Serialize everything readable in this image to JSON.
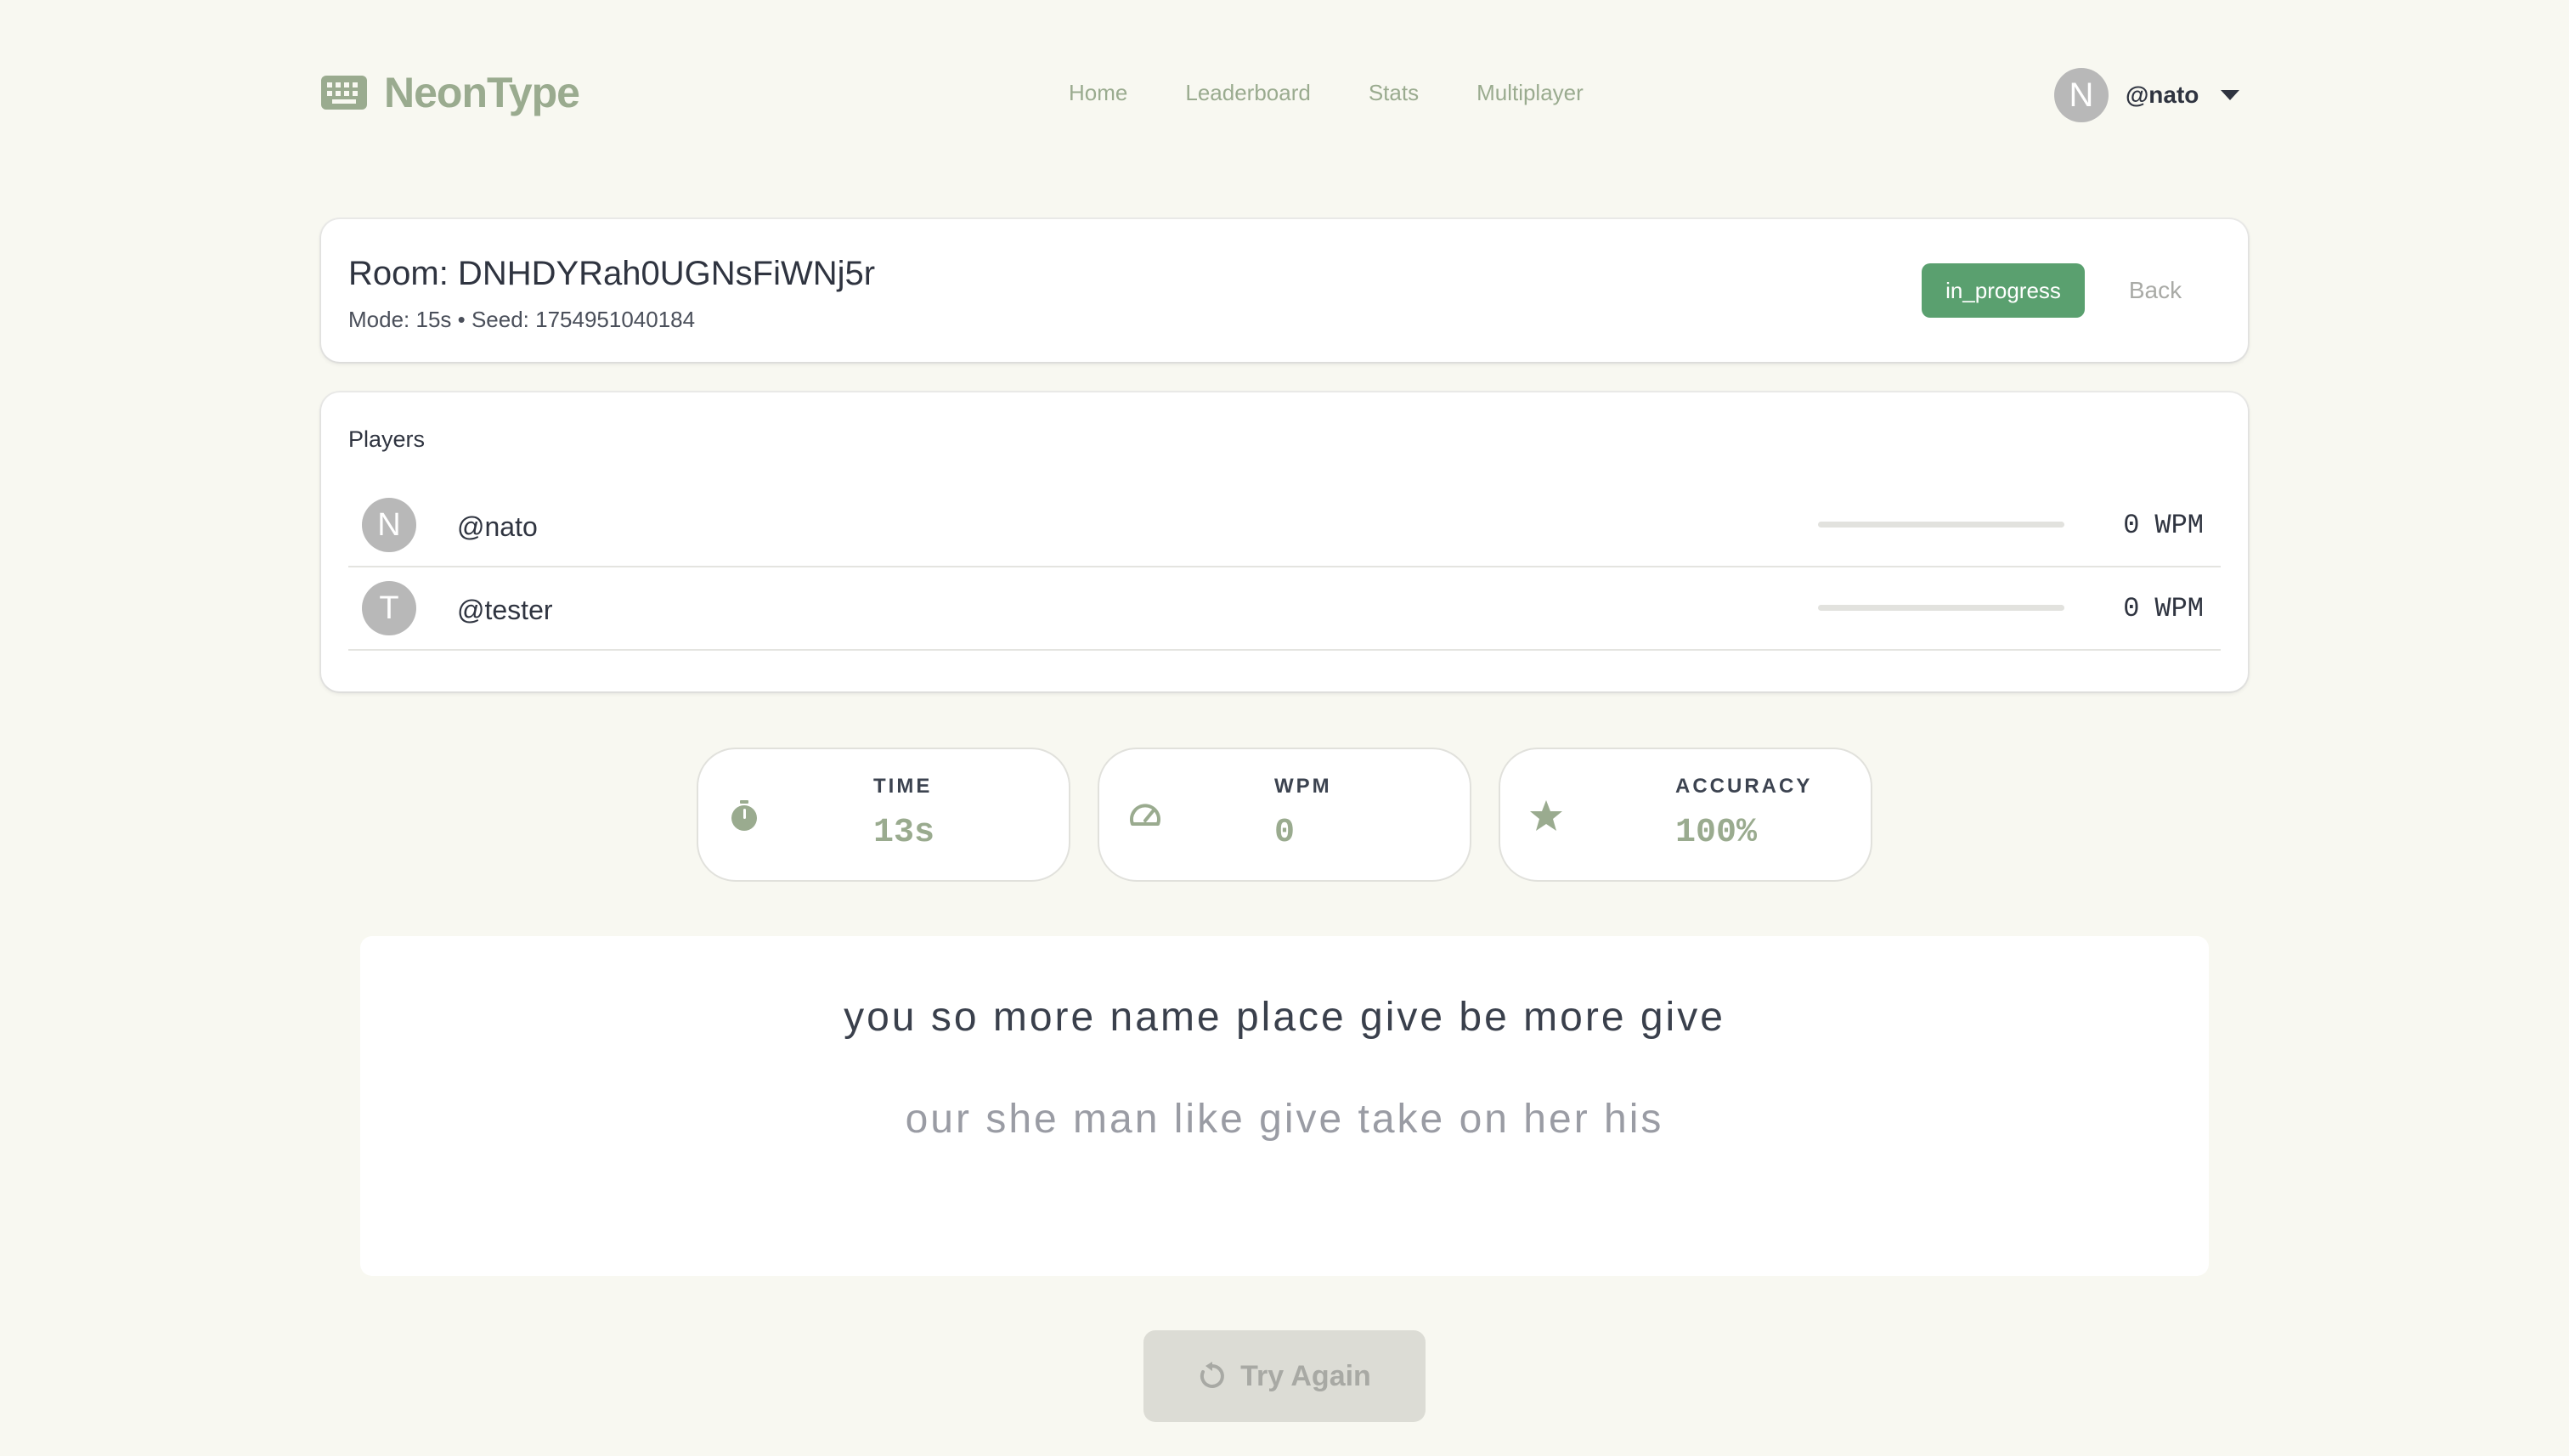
{
  "app": {
    "name": "NeonType"
  },
  "nav": {
    "items": [
      "Home",
      "Leaderboard",
      "Stats",
      "Multiplayer"
    ]
  },
  "user": {
    "avatar_letter": "N",
    "handle": "@nato"
  },
  "room": {
    "title": "Room: DNHDYRah0UGNsFiWNj5r",
    "subtitle": "Mode: 15s • Seed: 1754951040184",
    "status": "in_progress",
    "back_label": "Back"
  },
  "players": {
    "title": "Players",
    "list": [
      {
        "avatar_letter": "N",
        "name": "@nato",
        "wpm": "0",
        "unit": "WPM",
        "progress": 0
      },
      {
        "avatar_letter": "T",
        "name": "@tester",
        "wpm": "0",
        "unit": "WPM",
        "progress": 0
      }
    ]
  },
  "stats": {
    "time": {
      "label": "TIME",
      "value": "13s",
      "icon": "stopwatch-icon"
    },
    "wpm": {
      "label": "WPM",
      "value": "0",
      "icon": "speedometer-icon"
    },
    "accuracy": {
      "label": "ACCURACY",
      "value": "100%",
      "icon": "star-icon"
    }
  },
  "typing": {
    "line1": "you so more name place give be more give",
    "line2": "our she man like give take on her his"
  },
  "try_again": {
    "label": "Try Again",
    "icon": "restart-icon"
  },
  "colors": {
    "background": "#f8f8f1",
    "accent": "#9aab8f",
    "status_green": "#5aa06f"
  }
}
